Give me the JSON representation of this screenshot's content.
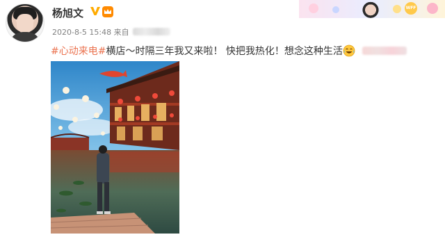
{
  "user": {
    "name": "杨旭文",
    "verified_icon": "verified-v-icon",
    "member_icon": "member-crown-icon"
  },
  "post": {
    "timestamp": "2020-8-5 15:48",
    "source_prefix": "来自",
    "hashtag": "#心动来电#",
    "text": "横店～时隔三年我又来啦！ 快把我热化！想念这种生活",
    "emoji": "laughing-tears-icon"
  },
  "banner": {
    "badge": "WFF"
  },
  "colors": {
    "hashtag": "#eb7350",
    "verified": "#ffab00",
    "username": "#333333",
    "meta": "#808080"
  }
}
